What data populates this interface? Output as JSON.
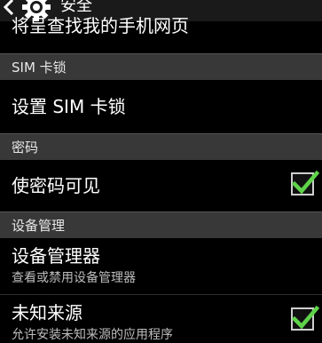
{
  "actionbar": {
    "title": "安全",
    "back_icon": "back-chevron-icon",
    "app_icon": "gear-icon"
  },
  "cut_row": {
    "label": "将呈查找我的手机网页"
  },
  "sections": [
    {
      "header": "SIM 卡锁"
    },
    {
      "header": "密码"
    },
    {
      "header": "设备管理"
    }
  ],
  "items": {
    "sim_lock": {
      "label": "设置 SIM 卡锁"
    },
    "show_password": {
      "label": "使密码可见",
      "checked": true
    },
    "device_admin": {
      "label": "设备管理器",
      "summary": "查看或禁用设备管理器"
    },
    "unknown_sources": {
      "label": "未知来源",
      "summary": "允许安装未知来源的应用程序",
      "checked": true
    }
  },
  "colors": {
    "check": "#5fd34a",
    "header_bg": "#383838",
    "background": "#000000"
  }
}
